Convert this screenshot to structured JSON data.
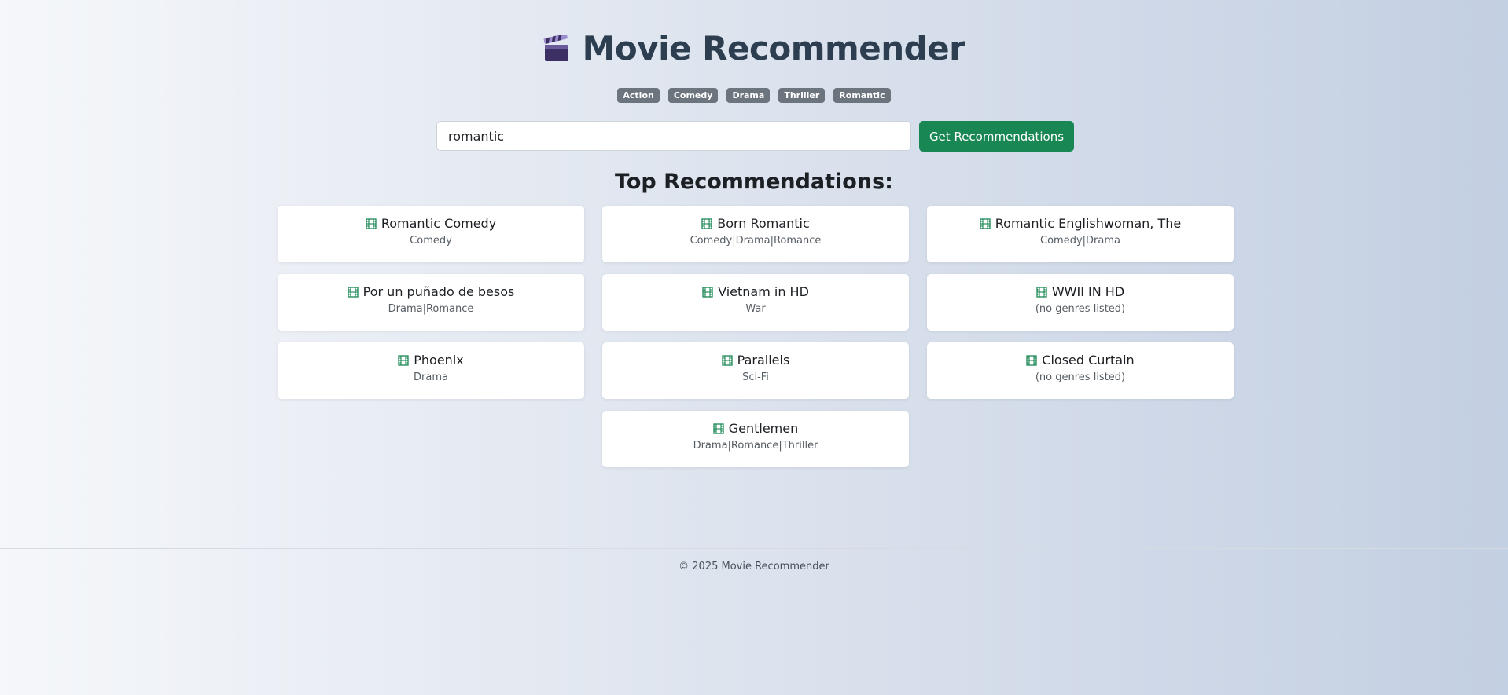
{
  "header": {
    "title": "Movie Recommender",
    "icon": "clapper-board-icon"
  },
  "genre_tags": [
    "Action",
    "Comedy",
    "Drama",
    "Thriller",
    "Romantic"
  ],
  "search": {
    "value": "romantic",
    "placeholder": "",
    "button_label": "Get Recommendations"
  },
  "results": {
    "heading": "Top Recommendations:",
    "items": [
      {
        "title": "Romantic Comedy",
        "genres": "Comedy"
      },
      {
        "title": "Born Romantic",
        "genres": "Comedy|Drama|Romance"
      },
      {
        "title": "Romantic Englishwoman, The",
        "genres": "Comedy|Drama"
      },
      {
        "title": "Por un puñado de besos",
        "genres": "Drama|Romance"
      },
      {
        "title": "Vietnam in HD",
        "genres": "War"
      },
      {
        "title": "WWII IN HD",
        "genres": "(no genres listed)"
      },
      {
        "title": "Phoenix",
        "genres": "Drama"
      },
      {
        "title": "Parallels",
        "genres": "Sci-Fi"
      },
      {
        "title": "Closed Curtain",
        "genres": "(no genres listed)"
      },
      {
        "title": "Gentlemen",
        "genres": "Drama|Romance|Thriller"
      }
    ]
  },
  "footer": {
    "text": "© 2025 Movie Recommender"
  },
  "colors": {
    "title": "#2c3e50",
    "tag_bg": "#6c757d",
    "button_bg": "#198754",
    "film_icon": "#198754"
  }
}
